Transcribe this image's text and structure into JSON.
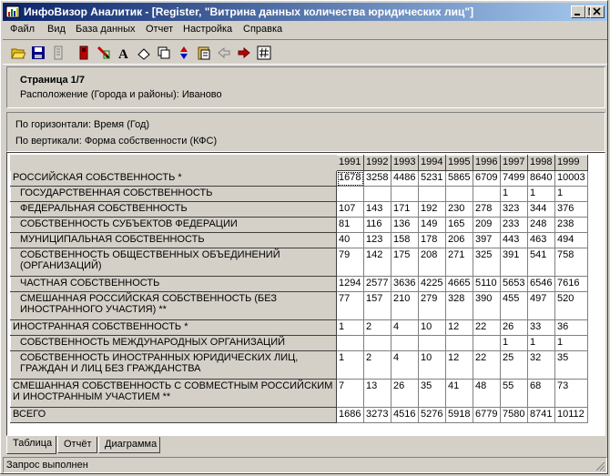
{
  "window": {
    "title": "ИнфоВизор Аналитик - [Register, \"Витрина данных количества юридических лиц\"]"
  },
  "menu": [
    "Файл",
    "Вид",
    "База данных",
    "Отчет",
    "Настройка",
    "Справка"
  ],
  "toolbar": {
    "icons": [
      "open-folder-icon",
      "save-disk-icon",
      "page-icon",
      "stop-icon",
      "pencil-edit-icon",
      "font-icon",
      "eraser-icon",
      "copy-icon",
      "sort-updown-icon",
      "clipboard-icon",
      "arrow-left-icon",
      "arrow-right-icon",
      "hash-icon"
    ]
  },
  "page": {
    "title": "Страница 1/7",
    "location": "Расположение (Города и районы): Иваново"
  },
  "axes": {
    "horizontal": "По горизонтали: Время (Год)",
    "vertical": "По вертикали: Форма собственности (КФС)"
  },
  "table": {
    "years": [
      "1991",
      "1992",
      "1993",
      "1994",
      "1995",
      "1996",
      "1997",
      "1998",
      "1999"
    ],
    "rows": [
      {
        "label": "РОССИЙСКАЯ СОБСТВЕННОСТЬ *",
        "indent": false,
        "values": [
          "1678",
          "3258",
          "4486",
          "5231",
          "5865",
          "6709",
          "7499",
          "8640",
          "10003"
        ]
      },
      {
        "label": "ГОСУДАРСТВЕННАЯ СОБСТВЕННОСТЬ",
        "indent": true,
        "values": [
          "",
          "",
          "",
          "",
          "",
          "",
          "1",
          "1",
          "1"
        ]
      },
      {
        "label": "ФЕДЕРАЛЬНАЯ СОБСТВЕННОСТЬ",
        "indent": true,
        "values": [
          "107",
          "143",
          "171",
          "192",
          "230",
          "278",
          "323",
          "344",
          "376"
        ]
      },
      {
        "label": "СОБСТВЕННОСТЬ СУБЪЕКТОВ ФЕДЕРАЦИИ",
        "indent": true,
        "values": [
          "81",
          "116",
          "136",
          "149",
          "165",
          "209",
          "233",
          "248",
          "238"
        ]
      },
      {
        "label": "МУНИЦИПАЛЬНАЯ  СОБСТВЕННОСТЬ",
        "indent": true,
        "values": [
          "40",
          "123",
          "158",
          "178",
          "206",
          "397",
          "443",
          "463",
          "494"
        ]
      },
      {
        "label": "СОБСТВЕННОСТЬ ОБЩЕСТВЕННЫХ ОБЪЕДИНЕНИЙ (ОРГАНИЗАЦИЙ)",
        "indent": true,
        "tall": true,
        "values": [
          "79",
          "142",
          "175",
          "208",
          "271",
          "325",
          "391",
          "541",
          "758"
        ]
      },
      {
        "label": "ЧАСТНАЯ СОБСТВЕННОСТЬ",
        "indent": true,
        "values": [
          "1294",
          "2577",
          "3636",
          "4225",
          "4665",
          "5110",
          "5653",
          "6546",
          "7616"
        ]
      },
      {
        "label": "СМЕШАННАЯ РОССИЙСКАЯ СОБСТВЕННОСТЬ (БЕЗ ИНОСТРАННОГО УЧАСТИЯ) **",
        "indent": true,
        "tall": true,
        "values": [
          "77",
          "157",
          "210",
          "279",
          "328",
          "390",
          "455",
          "497",
          "520"
        ]
      },
      {
        "label": "ИНОСТРАННАЯ СОБСТВЕННОСТЬ *",
        "indent": false,
        "values": [
          "1",
          "2",
          "4",
          "10",
          "12",
          "22",
          "26",
          "33",
          "36"
        ]
      },
      {
        "label": "СОБСТВЕННОСТЬ МЕЖДУНАРОДНЫХ ОРГАНИЗАЦИЙ",
        "indent": true,
        "values": [
          "",
          "",
          "",
          "",
          "",
          "",
          "1",
          "1",
          "1"
        ]
      },
      {
        "label": "СОБСТВЕННОСТЬ ИНОСТРАННЫХ ЮРИДИЧЕСКИХ ЛИЦ, ГРАЖДАН И ЛИЦ БЕЗ ГРАЖДАНСТВА",
        "indent": true,
        "tall": true,
        "values": [
          "1",
          "2",
          "4",
          "10",
          "12",
          "22",
          "25",
          "32",
          "35"
        ]
      },
      {
        "label": "СМЕШАННАЯ СОБСТВЕННОСТЬ С СОВМЕСТНЫМ РОССИЙСКИМ И ИНОСТРАННЫМ УЧАСТИЕМ **",
        "indent": false,
        "tall": true,
        "values": [
          "7",
          "13",
          "26",
          "35",
          "41",
          "48",
          "55",
          "68",
          "73"
        ]
      },
      {
        "label": "ВСЕГО",
        "indent": false,
        "values": [
          "1686",
          "3273",
          "4516",
          "5276",
          "5918",
          "6779",
          "7580",
          "8741",
          "10112"
        ]
      }
    ]
  },
  "tabs": [
    "Таблица",
    "Отчёт",
    "Диаграмма"
  ],
  "status": "Запрос выполнен"
}
